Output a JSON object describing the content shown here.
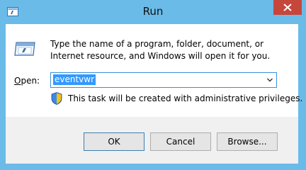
{
  "window": {
    "title": "Run",
    "close_glyph": "✕"
  },
  "dialog": {
    "description": "Type the name of a program, folder, document, or Internet resource, and Windows will open it for you.",
    "open_label_prefix": "O",
    "open_label_rest": "pen:",
    "open_value": "eventvwr",
    "admin_note": "This task will be created with administrative privileges."
  },
  "buttons": {
    "ok": "OK",
    "cancel": "Cancel",
    "browse": "Browse..."
  },
  "icons": {
    "title": "run-icon",
    "dialog": "run-icon",
    "shield": "uac-shield-icon",
    "dropdown": "chevron-down-icon",
    "close": "close-icon"
  },
  "colors": {
    "title_bar": "#6bbbe9",
    "close_button": "#c7463b",
    "selection": "#3399ff",
    "focus_border": "#3b8fd9"
  }
}
